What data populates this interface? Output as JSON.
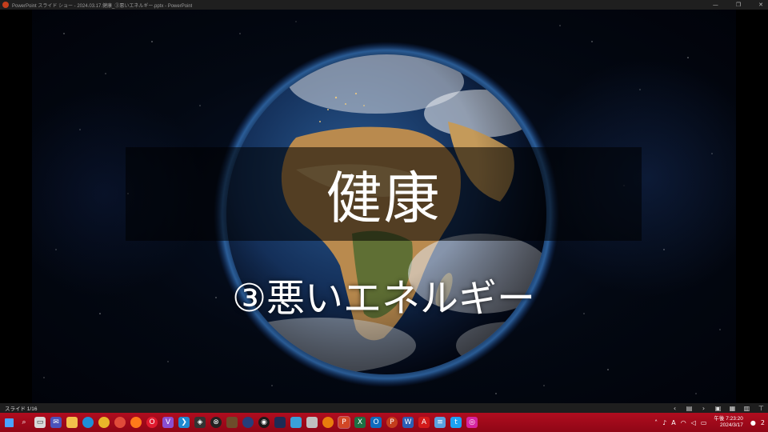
{
  "window": {
    "title": "PowerPoint スライド ショー - 2024.03.17.健康_③悪いエネルギー.pptx - PowerPoint",
    "controls": [
      "—",
      "❐",
      "✕"
    ]
  },
  "slide": {
    "title": "健康",
    "subtitle": "③悪いエネルギー"
  },
  "statusbar": {
    "slide_counter": "スライド 1/16"
  },
  "taskbar": {
    "clock_time": "午後 7:23:20",
    "clock_date": "2024/3/17",
    "ime_indicator": "A",
    "notification_count": "2",
    "colors": {
      "bar": "#a8081a"
    }
  }
}
